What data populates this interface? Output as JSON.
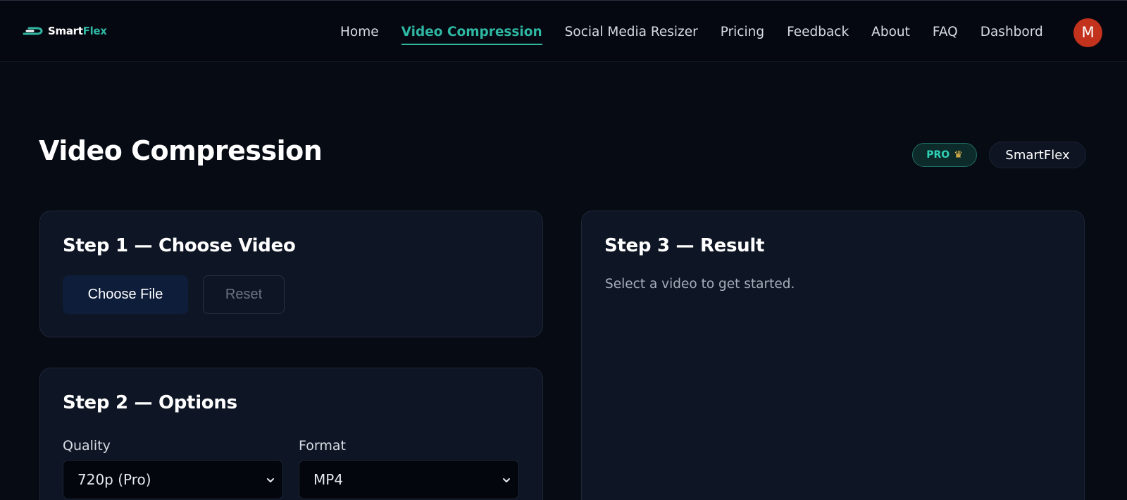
{
  "brand": {
    "logo_text_main": "Smart",
    "logo_text_accent": "Flex"
  },
  "nav": {
    "items": [
      {
        "label": "Home"
      },
      {
        "label": "Video Compression",
        "active": true
      },
      {
        "label": "Social Media Resizer"
      },
      {
        "label": "Pricing"
      },
      {
        "label": "Feedback"
      },
      {
        "label": "About"
      },
      {
        "label": "FAQ"
      },
      {
        "label": "Dashbord"
      }
    ],
    "avatar_initial": "M",
    "accent_color": "#2fb7a3",
    "avatar_color": "#c2321c"
  },
  "page": {
    "title": "Video Compression",
    "pro_badge": "PRO",
    "pro_icon": "crown-icon",
    "brand_badge": "SmartFlex"
  },
  "step1": {
    "title": "Step 1 — Choose Video",
    "choose_label": "Choose File",
    "reset_label": "Reset"
  },
  "step2": {
    "title": "Step 2 — Options",
    "quality_label": "Quality",
    "quality_value": "720p (Pro)",
    "format_label": "Format",
    "format_value": "MP4"
  },
  "step3": {
    "title": "Step 3 — Result",
    "hint": "Select a video to get started."
  }
}
